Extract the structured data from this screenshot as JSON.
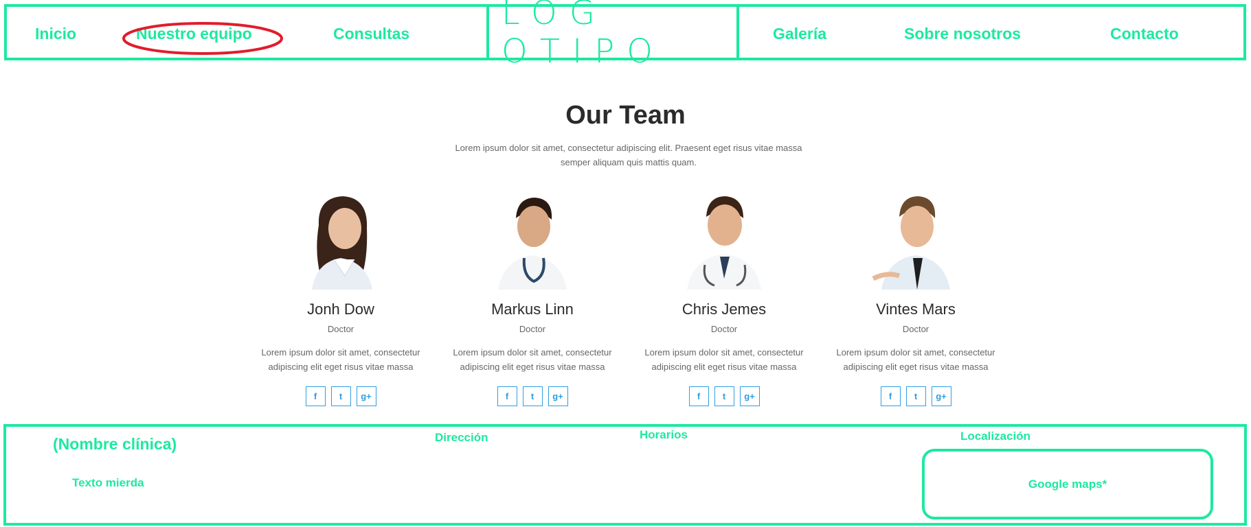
{
  "header": {
    "nav_left": [
      "Inicio",
      "Nuestro equipo",
      "Consultas"
    ],
    "logo": "LOG OTIPO",
    "nav_right": [
      "Galería",
      "Sobre nosotros",
      "Contacto"
    ],
    "highlight_color": "#e01d2c",
    "accent_color": "#1de9a0"
  },
  "team": {
    "title": "Our Team",
    "subtitle": "Lorem ipsum dolor sit amet, consectetur adipiscing elit. Praesent eget risus vitae massa semper aliquam quis mattis quam.",
    "members": [
      {
        "name": "Jonh Dow",
        "role": "Doctor",
        "desc": "Lorem ipsum dolor sit amet, consectetur adipiscing elit eget risus vitae massa"
      },
      {
        "name": "Markus Linn",
        "role": "Doctor",
        "desc": "Lorem ipsum dolor sit amet, consectetur adipiscing elit eget risus vitae massa"
      },
      {
        "name": "Chris Jemes",
        "role": "Doctor",
        "desc": "Lorem ipsum dolor sit amet, consectetur adipiscing elit eget risus vitae massa"
      },
      {
        "name": "Vintes Mars",
        "role": "Doctor",
        "desc": "Lorem ipsum dolor sit amet, consectetur adipiscing elit eget risus vitae massa"
      }
    ],
    "social_icons": [
      "facebook-icon",
      "twitter-icon",
      "google-plus-icon"
    ],
    "social_glyphs": [
      "f",
      "t",
      "g+"
    ],
    "social_color": "#2f9ee0"
  },
  "footer": {
    "clinic_name": "(Nombre clínica)",
    "body_text": "Texto mierda",
    "address_label": "Dirección",
    "hours_label": "Horarios",
    "location_label": "Localización",
    "map_placeholder": "Google maps*"
  }
}
